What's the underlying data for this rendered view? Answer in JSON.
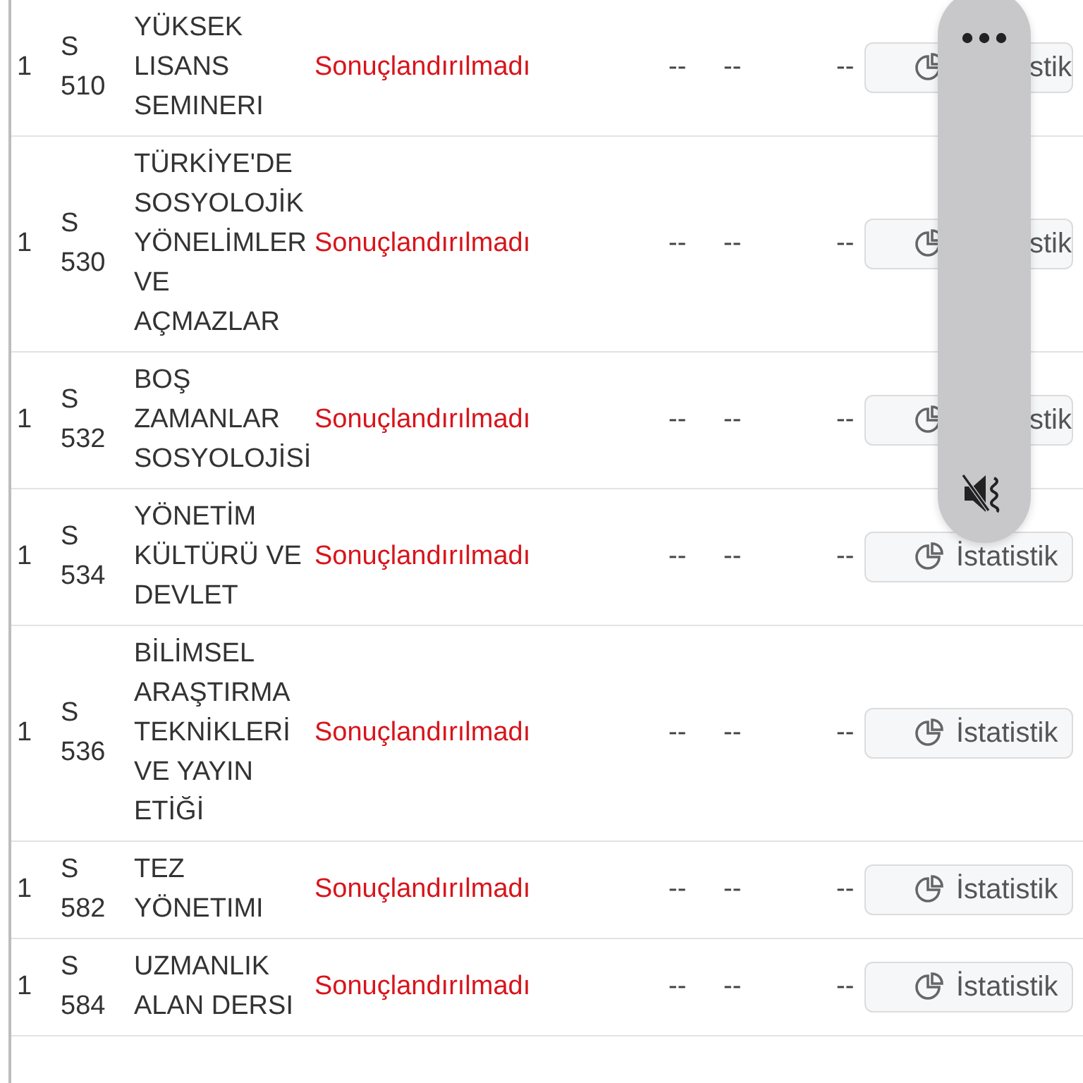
{
  "rows": [
    {
      "col_1": "1",
      "code": "S 510",
      "name": "YÜKSEK LISANS SEMINERI",
      "status": "Sonuçlandırılmadı",
      "col_5": "--",
      "col_6": "--",
      "col_7": "--",
      "button": {
        "label": "stik",
        "hidden_part": true
      }
    },
    {
      "col_1": "1",
      "code": "S 530",
      "name": "TÜRKİYE'DE SOSYOLOJİK YÖNELİMLER VE AÇMAZLAR",
      "status": "Sonuçlandırılmadı",
      "col_5": "--",
      "col_6": "--",
      "col_7": "--",
      "button": {
        "label": "stik",
        "hidden_part": true
      }
    },
    {
      "col_1": "1",
      "code": "S 532",
      "name": "BOŞ ZAMANLAR SOSYOLOJİSİ",
      "status": "Sonuçlandırılmadı",
      "col_5": "--",
      "col_6": "--",
      "col_7": "--",
      "button": {
        "label": "stik",
        "hidden_part": true
      }
    },
    {
      "col_1": "1",
      "code": "S 534",
      "name": "YÖNETİM KÜLTÜRÜ VE DEVLET",
      "status": "Sonuçlandırılmadı",
      "col_5": "--",
      "col_6": "--",
      "col_7": "--",
      "button": {
        "label": "İstatistik",
        "hidden_part": false
      }
    },
    {
      "col_1": "1",
      "code": "S 536",
      "name": "BİLİMSEL ARAŞTIRMA TEKNİKLERİ VE YAYIN ETİĞİ",
      "status": "Sonuçlandırılmadı",
      "col_5": "--",
      "col_6": "--",
      "col_7": "--",
      "button": {
        "label": "İstatistik",
        "hidden_part": false
      }
    },
    {
      "col_1": "1",
      "code": "S 582",
      "name": "TEZ YÖNETIMI",
      "status": "Sonuçlandırılmadı",
      "col_5": "--",
      "col_6": "--",
      "col_7": "--",
      "button": {
        "label": "İstatistik",
        "hidden_part": false
      }
    },
    {
      "col_1": "1",
      "code": "S 584",
      "name": "UZMANLIK ALAN DERSI",
      "status": "Sonuçlandırılmadı",
      "col_5": "--",
      "col_6": "--",
      "col_7": "--",
      "button": {
        "label": "İstatistik",
        "hidden_part": false
      }
    }
  ],
  "overlay": {
    "muted": true
  }
}
